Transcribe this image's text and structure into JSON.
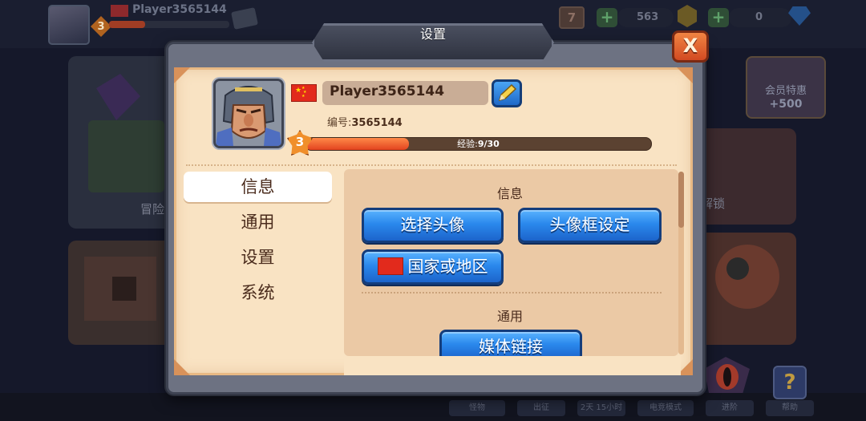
{
  "background": {
    "player_name": "Player3565144",
    "player_level": "3",
    "calendar_day": "7",
    "currency_a": "563",
    "currency_b": "0",
    "promo": {
      "title": "会员特惠",
      "bonus": "+500"
    },
    "side_labels": {
      "adventure": "冒险",
      "unlock": "解锁"
    },
    "bottom_nav": [
      "怪物",
      "出征",
      "2天 15小时",
      "电竞模式",
      "进阶",
      "帮助"
    ]
  },
  "modal": {
    "title": "设置",
    "close_label": "X",
    "profile": {
      "name": "Player3565144",
      "id_label": "编号:",
      "id_value": "3565144",
      "level": "3",
      "xp_label": "经验:",
      "xp_value": "9/30",
      "xp_current": 9,
      "xp_max": 30
    },
    "tabs": [
      {
        "label": "信息",
        "active": true
      },
      {
        "label": "通用",
        "active": false
      },
      {
        "label": "设置",
        "active": false
      },
      {
        "label": "系统",
        "active": false
      }
    ],
    "sections": {
      "info": {
        "heading": "信息",
        "select_avatar": "选择头像",
        "frame_settings": "头像框设定",
        "country_region": "国家或地区"
      },
      "general": {
        "heading": "通用",
        "media_links": "媒体链接"
      }
    }
  },
  "colors": {
    "parchment": "#f9e3c3",
    "button_blue": "#2a88ec",
    "close_orange": "#e2632e",
    "xp_fill": "#f0622c"
  }
}
